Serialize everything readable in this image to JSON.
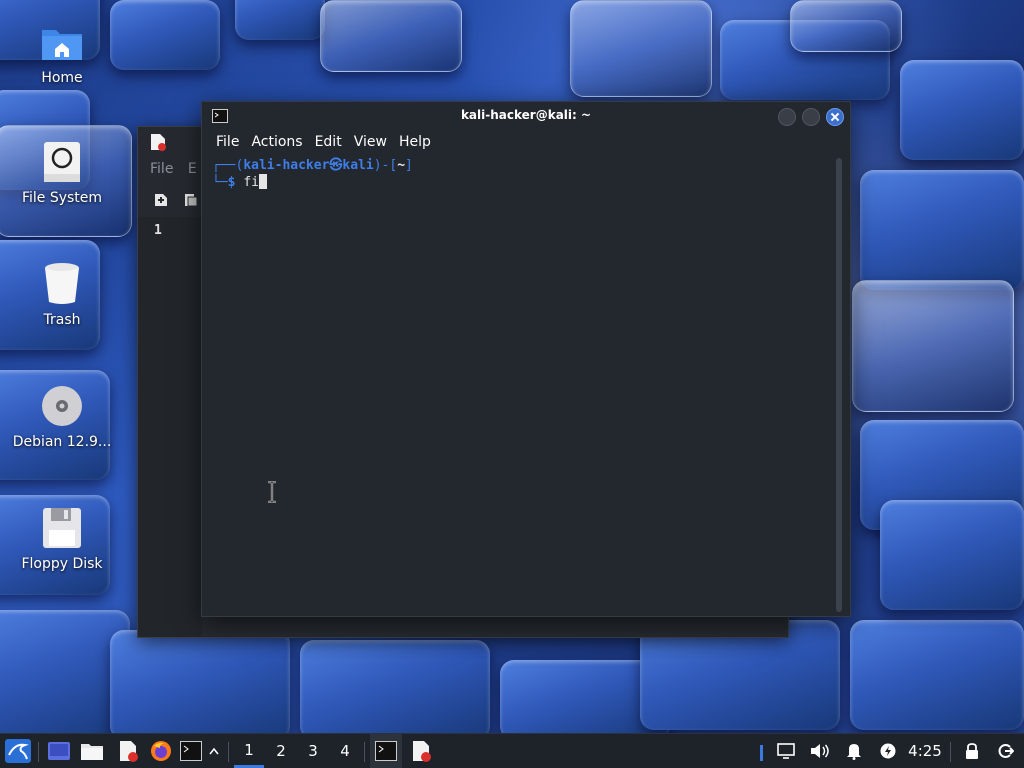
{
  "desktop": {
    "icons": [
      {
        "label": "Home",
        "icon": "home-folder-icon"
      },
      {
        "label": "File System",
        "icon": "drive-icon"
      },
      {
        "label": "Trash",
        "icon": "trash-icon"
      },
      {
        "label": "Debian 12.9...",
        "icon": "disc-icon"
      },
      {
        "label": "Floppy Disk",
        "icon": "floppy-icon"
      }
    ]
  },
  "editor": {
    "menu_file": "File",
    "menu_edit_partial": "E",
    "line_number": "1"
  },
  "terminal": {
    "title": "kali-hacker@kali: ~",
    "menu": [
      "File",
      "Actions",
      "Edit",
      "View",
      "Help"
    ],
    "prompt": {
      "open": "┌──(",
      "user_host": "kali-hacker㉿kali",
      "mid": ")-[",
      "dir": "~",
      "close": "]",
      "line2_prefix": "└─",
      "symbol": "$",
      "command": "fi"
    }
  },
  "taskbar": {
    "workspaces": [
      "1",
      "2",
      "3",
      "4"
    ],
    "clock": "4:25",
    "accent": "#3b7ae0"
  }
}
